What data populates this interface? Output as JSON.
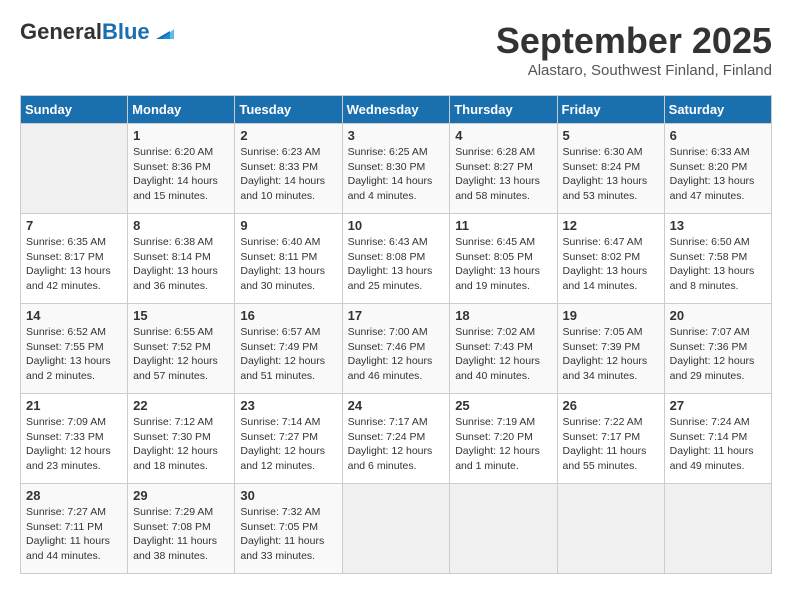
{
  "header": {
    "logo_general": "General",
    "logo_blue": "Blue",
    "month_title": "September 2025",
    "location": "Alastaro, Southwest Finland, Finland"
  },
  "days_of_week": [
    "Sunday",
    "Monday",
    "Tuesday",
    "Wednesday",
    "Thursday",
    "Friday",
    "Saturday"
  ],
  "weeks": [
    [
      {
        "day": "",
        "info": ""
      },
      {
        "day": "1",
        "info": "Sunrise: 6:20 AM\nSunset: 8:36 PM\nDaylight: 14 hours\nand 15 minutes."
      },
      {
        "day": "2",
        "info": "Sunrise: 6:23 AM\nSunset: 8:33 PM\nDaylight: 14 hours\nand 10 minutes."
      },
      {
        "day": "3",
        "info": "Sunrise: 6:25 AM\nSunset: 8:30 PM\nDaylight: 14 hours\nand 4 minutes."
      },
      {
        "day": "4",
        "info": "Sunrise: 6:28 AM\nSunset: 8:27 PM\nDaylight: 13 hours\nand 58 minutes."
      },
      {
        "day": "5",
        "info": "Sunrise: 6:30 AM\nSunset: 8:24 PM\nDaylight: 13 hours\nand 53 minutes."
      },
      {
        "day": "6",
        "info": "Sunrise: 6:33 AM\nSunset: 8:20 PM\nDaylight: 13 hours\nand 47 minutes."
      }
    ],
    [
      {
        "day": "7",
        "info": "Sunrise: 6:35 AM\nSunset: 8:17 PM\nDaylight: 13 hours\nand 42 minutes."
      },
      {
        "day": "8",
        "info": "Sunrise: 6:38 AM\nSunset: 8:14 PM\nDaylight: 13 hours\nand 36 minutes."
      },
      {
        "day": "9",
        "info": "Sunrise: 6:40 AM\nSunset: 8:11 PM\nDaylight: 13 hours\nand 30 minutes."
      },
      {
        "day": "10",
        "info": "Sunrise: 6:43 AM\nSunset: 8:08 PM\nDaylight: 13 hours\nand 25 minutes."
      },
      {
        "day": "11",
        "info": "Sunrise: 6:45 AM\nSunset: 8:05 PM\nDaylight: 13 hours\nand 19 minutes."
      },
      {
        "day": "12",
        "info": "Sunrise: 6:47 AM\nSunset: 8:02 PM\nDaylight: 13 hours\nand 14 minutes."
      },
      {
        "day": "13",
        "info": "Sunrise: 6:50 AM\nSunset: 7:58 PM\nDaylight: 13 hours\nand 8 minutes."
      }
    ],
    [
      {
        "day": "14",
        "info": "Sunrise: 6:52 AM\nSunset: 7:55 PM\nDaylight: 13 hours\nand 2 minutes."
      },
      {
        "day": "15",
        "info": "Sunrise: 6:55 AM\nSunset: 7:52 PM\nDaylight: 12 hours\nand 57 minutes."
      },
      {
        "day": "16",
        "info": "Sunrise: 6:57 AM\nSunset: 7:49 PM\nDaylight: 12 hours\nand 51 minutes."
      },
      {
        "day": "17",
        "info": "Sunrise: 7:00 AM\nSunset: 7:46 PM\nDaylight: 12 hours\nand 46 minutes."
      },
      {
        "day": "18",
        "info": "Sunrise: 7:02 AM\nSunset: 7:43 PM\nDaylight: 12 hours\nand 40 minutes."
      },
      {
        "day": "19",
        "info": "Sunrise: 7:05 AM\nSunset: 7:39 PM\nDaylight: 12 hours\nand 34 minutes."
      },
      {
        "day": "20",
        "info": "Sunrise: 7:07 AM\nSunset: 7:36 PM\nDaylight: 12 hours\nand 29 minutes."
      }
    ],
    [
      {
        "day": "21",
        "info": "Sunrise: 7:09 AM\nSunset: 7:33 PM\nDaylight: 12 hours\nand 23 minutes."
      },
      {
        "day": "22",
        "info": "Sunrise: 7:12 AM\nSunset: 7:30 PM\nDaylight: 12 hours\nand 18 minutes."
      },
      {
        "day": "23",
        "info": "Sunrise: 7:14 AM\nSunset: 7:27 PM\nDaylight: 12 hours\nand 12 minutes."
      },
      {
        "day": "24",
        "info": "Sunrise: 7:17 AM\nSunset: 7:24 PM\nDaylight: 12 hours\nand 6 minutes."
      },
      {
        "day": "25",
        "info": "Sunrise: 7:19 AM\nSunset: 7:20 PM\nDaylight: 12 hours\nand 1 minute."
      },
      {
        "day": "26",
        "info": "Sunrise: 7:22 AM\nSunset: 7:17 PM\nDaylight: 11 hours\nand 55 minutes."
      },
      {
        "day": "27",
        "info": "Sunrise: 7:24 AM\nSunset: 7:14 PM\nDaylight: 11 hours\nand 49 minutes."
      }
    ],
    [
      {
        "day": "28",
        "info": "Sunrise: 7:27 AM\nSunset: 7:11 PM\nDaylight: 11 hours\nand 44 minutes."
      },
      {
        "day": "29",
        "info": "Sunrise: 7:29 AM\nSunset: 7:08 PM\nDaylight: 11 hours\nand 38 minutes."
      },
      {
        "day": "30",
        "info": "Sunrise: 7:32 AM\nSunset: 7:05 PM\nDaylight: 11 hours\nand 33 minutes."
      },
      {
        "day": "",
        "info": ""
      },
      {
        "day": "",
        "info": ""
      },
      {
        "day": "",
        "info": ""
      },
      {
        "day": "",
        "info": ""
      }
    ]
  ]
}
